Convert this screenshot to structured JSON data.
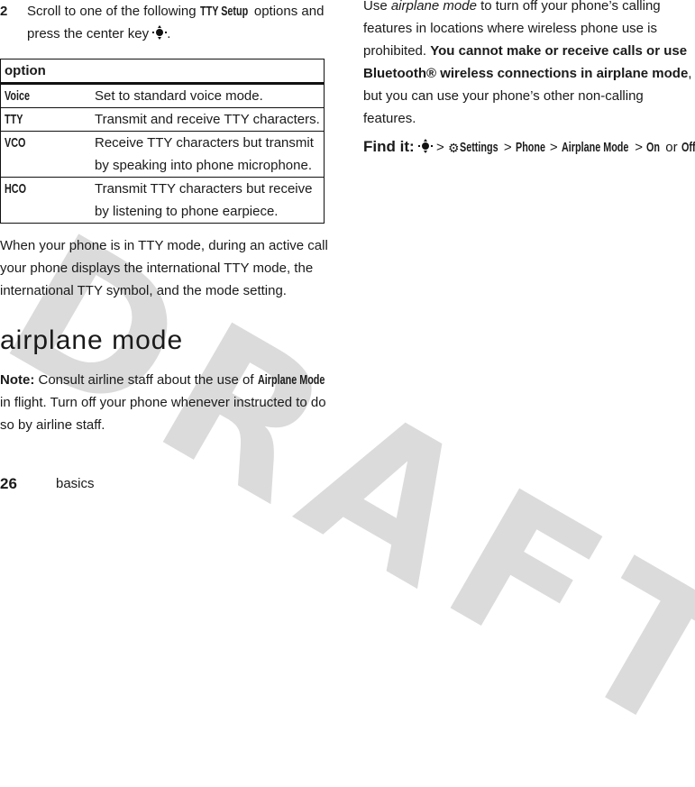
{
  "watermark": "DRAFT",
  "step": {
    "number": "2",
    "text_before": "Scroll to one of the following ",
    "menu_name": "TTY Setup",
    "text_after": " options and press the center key",
    "end": "."
  },
  "table": {
    "header": "option",
    "rows": [
      {
        "key": "Voice",
        "desc": "Set to standard voice mode."
      },
      {
        "key": "TTY",
        "desc": "Transmit and receive TTY characters."
      },
      {
        "key": "VCO",
        "desc": "Receive TTY characters but transmit by speaking into phone microphone."
      },
      {
        "key": "HCO",
        "desc": "Transmit TTY characters but receive by listening to phone earpiece."
      }
    ]
  },
  "tty_paragraph": "When your phone is in TTY mode, during an active call your phone displays the international TTY mode, the international TTY symbol, and the mode setting.",
  "section_heading": "airplane mode",
  "note": {
    "label": "Note:",
    "text_before": " Consult airline staff about the use of ",
    "menu_name": "Airplane Mode",
    "text_after": " in flight. Turn off your phone whenever instructed to do so by airline staff."
  },
  "right_column": {
    "use": "Use ",
    "term": "airplane mode",
    "text1": " to turn off your phone’s calling features in locations where wireless phone use is prohibited. ",
    "bold": "You cannot make or receive calls or use Bluetooth® wireless connections in airplane mode",
    "text2": ", but you can use your phone’s other non-calling features."
  },
  "find_it": {
    "label": "Find it:",
    "sep": ">",
    "path": [
      "Settings",
      "Phone",
      "Airplane Mode"
    ],
    "on": "On",
    "or": "or",
    "off": "Off"
  },
  "footer": {
    "page_number": "26",
    "section": "basics"
  }
}
